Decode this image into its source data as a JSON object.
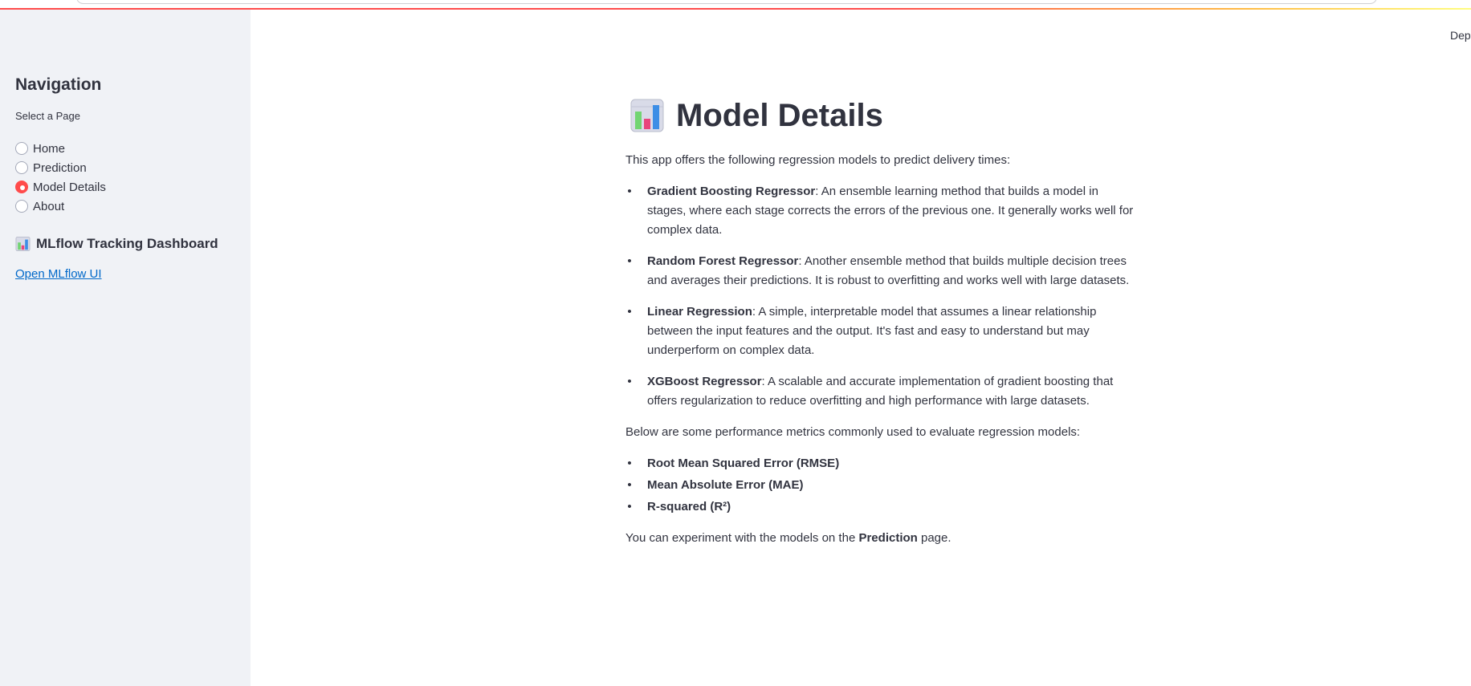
{
  "header": {
    "deploy_label": "Deploy"
  },
  "sidebar": {
    "title": "Navigation",
    "select_label": "Select a Page",
    "pages": [
      {
        "label": "Home",
        "selected": false
      },
      {
        "label": "Prediction",
        "selected": false
      },
      {
        "label": "Model Details",
        "selected": true
      },
      {
        "label": "About",
        "selected": false
      }
    ],
    "mlflow": {
      "heading": "MLflow Tracking Dashboard",
      "icon": "bar-chart-icon",
      "link_label": "Open MLflow UI"
    }
  },
  "main": {
    "title": "Model Details",
    "title_icon": "bar-chart-icon",
    "intro": "This app offers the following regression models to predict delivery times:",
    "models": [
      {
        "name": "Gradient Boosting Regressor",
        "description": ": An ensemble learning method that builds a model in stages, where each stage corrects the errors of the previous one. It generally works well for complex data."
      },
      {
        "name": "Random Forest Regressor",
        "description": ": Another ensemble method that builds multiple decision trees and averages their predictions. It is robust to overfitting and works well with large datasets."
      },
      {
        "name": "Linear Regression",
        "description": ": A simple, interpretable model that assumes a linear relationship between the input features and the output. It's fast and easy to understand but may underperform on complex data."
      },
      {
        "name": "XGBoost Regressor",
        "description": ": A scalable and accurate implementation of gradient boosting that offers regularization to reduce overfitting and high performance with large datasets."
      }
    ],
    "metrics_intro": "Below are some performance metrics commonly used to evaluate regression models:",
    "metrics": [
      "Root Mean Squared Error (RMSE)",
      "Mean Absolute Error (MAE)",
      "R-squared (R²)"
    ],
    "outro_prefix": "You can experiment with the models on the ",
    "outro_bold": "Prediction",
    "outro_suffix": " page."
  },
  "colors": {
    "accent": "#ff4b4b",
    "sidebar_bg": "#f0f2f6",
    "text": "#31333f",
    "link": "#0068c9"
  }
}
